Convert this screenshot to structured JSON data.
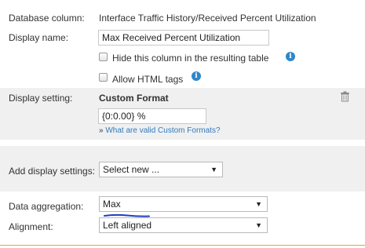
{
  "database_column": {
    "label": "Database column:",
    "value": "Interface Traffic History/Received Percent Utilization"
  },
  "display_name": {
    "label": "Display name:",
    "value": "Max Received Percent Utilization"
  },
  "options": {
    "hide_column_label": "Hide this column in the resulting table",
    "allow_html_label": "Allow HTML tags"
  },
  "display_setting": {
    "label": "Display setting:",
    "title": "Custom Format",
    "format_value": "{0:0.00} %",
    "help_link_prefix": "»",
    "help_link": "What are valid Custom Formats?"
  },
  "add_display_settings": {
    "label": "Add display settings:",
    "selected": "Select new ..."
  },
  "data_aggregation": {
    "label": "Data aggregation:",
    "selected": "Max"
  },
  "alignment": {
    "label": "Alignment:",
    "selected": "Left aligned"
  },
  "icons": {
    "info": "info-icon",
    "trash": "trash-icon",
    "dropdown": "chevron-down-icon"
  },
  "colors": {
    "accent": "#2e87c8",
    "panel": "#f0f0f0",
    "underline_annotation": "#1f3fbf",
    "bottom_rule": "#c8b040"
  }
}
